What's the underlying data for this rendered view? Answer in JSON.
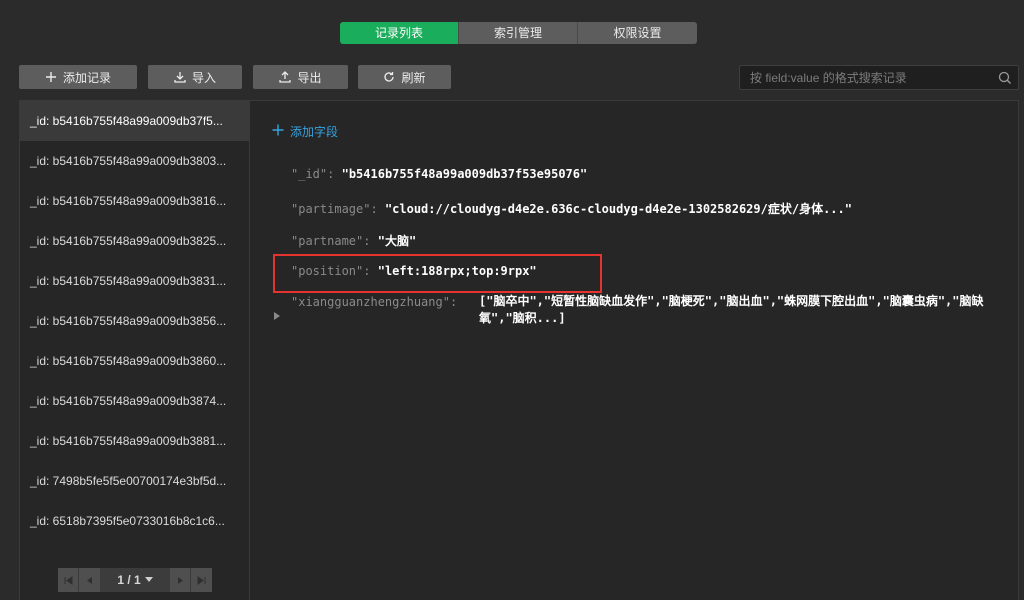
{
  "tabs": [
    {
      "label": "记录列表",
      "active": true
    },
    {
      "label": "索引管理",
      "active": false
    },
    {
      "label": "权限设置",
      "active": false
    }
  ],
  "toolbar": {
    "add_label": "添加记录",
    "import_label": "导入",
    "export_label": "导出",
    "refresh_label": "刷新",
    "search_placeholder": "按 field:value 的格式搜索记录"
  },
  "records": [
    "_id: b5416b755f48a99a009db37f5...",
    "_id: b5416b755f48a99a009db3803...",
    "_id: b5416b755f48a99a009db3816...",
    "_id: b5416b755f48a99a009db3825...",
    "_id: b5416b755f48a99a009db3831...",
    "_id: b5416b755f48a99a009db3856...",
    "_id: b5416b755f48a99a009db3860...",
    "_id: b5416b755f48a99a009db3874...",
    "_id: b5416b755f48a99a009db3881...",
    "_id: 7498b5fe5f5e00700174e3bf5d...",
    "_id: 6518b7395f5e0733016b8c1c6..."
  ],
  "pager": {
    "label": "1 / 1"
  },
  "detail": {
    "add_field_label": "添加字段",
    "fields": [
      {
        "key": "\"_id\":",
        "value": "\"b5416b755f48a99a009db37f53e95076\""
      },
      {
        "key": "\"partimage\":",
        "value": "\"cloud://cloudyg-d4e2e.636c-cloudyg-d4e2e-1302582629/症状/身体...\""
      },
      {
        "key": "\"partname\":",
        "value": "\"大脑\""
      },
      {
        "key": "\"position\":",
        "value": "\"left:188rpx;top:9rpx\""
      },
      {
        "key": "\"xiangguanzhengzhuang\":",
        "value": "[\"脑卒中\",\"短暂性脑缺血发作\",\"脑梗死\",\"脑出血\",\"蛛网膜下腔出血\",\"脑囊虫病\",\"脑缺氧\",\"脑积...]"
      }
    ]
  },
  "colors": {
    "accent_green": "#1aad5b",
    "link_blue": "#36a3e0",
    "highlight_red": "#e5332f"
  }
}
